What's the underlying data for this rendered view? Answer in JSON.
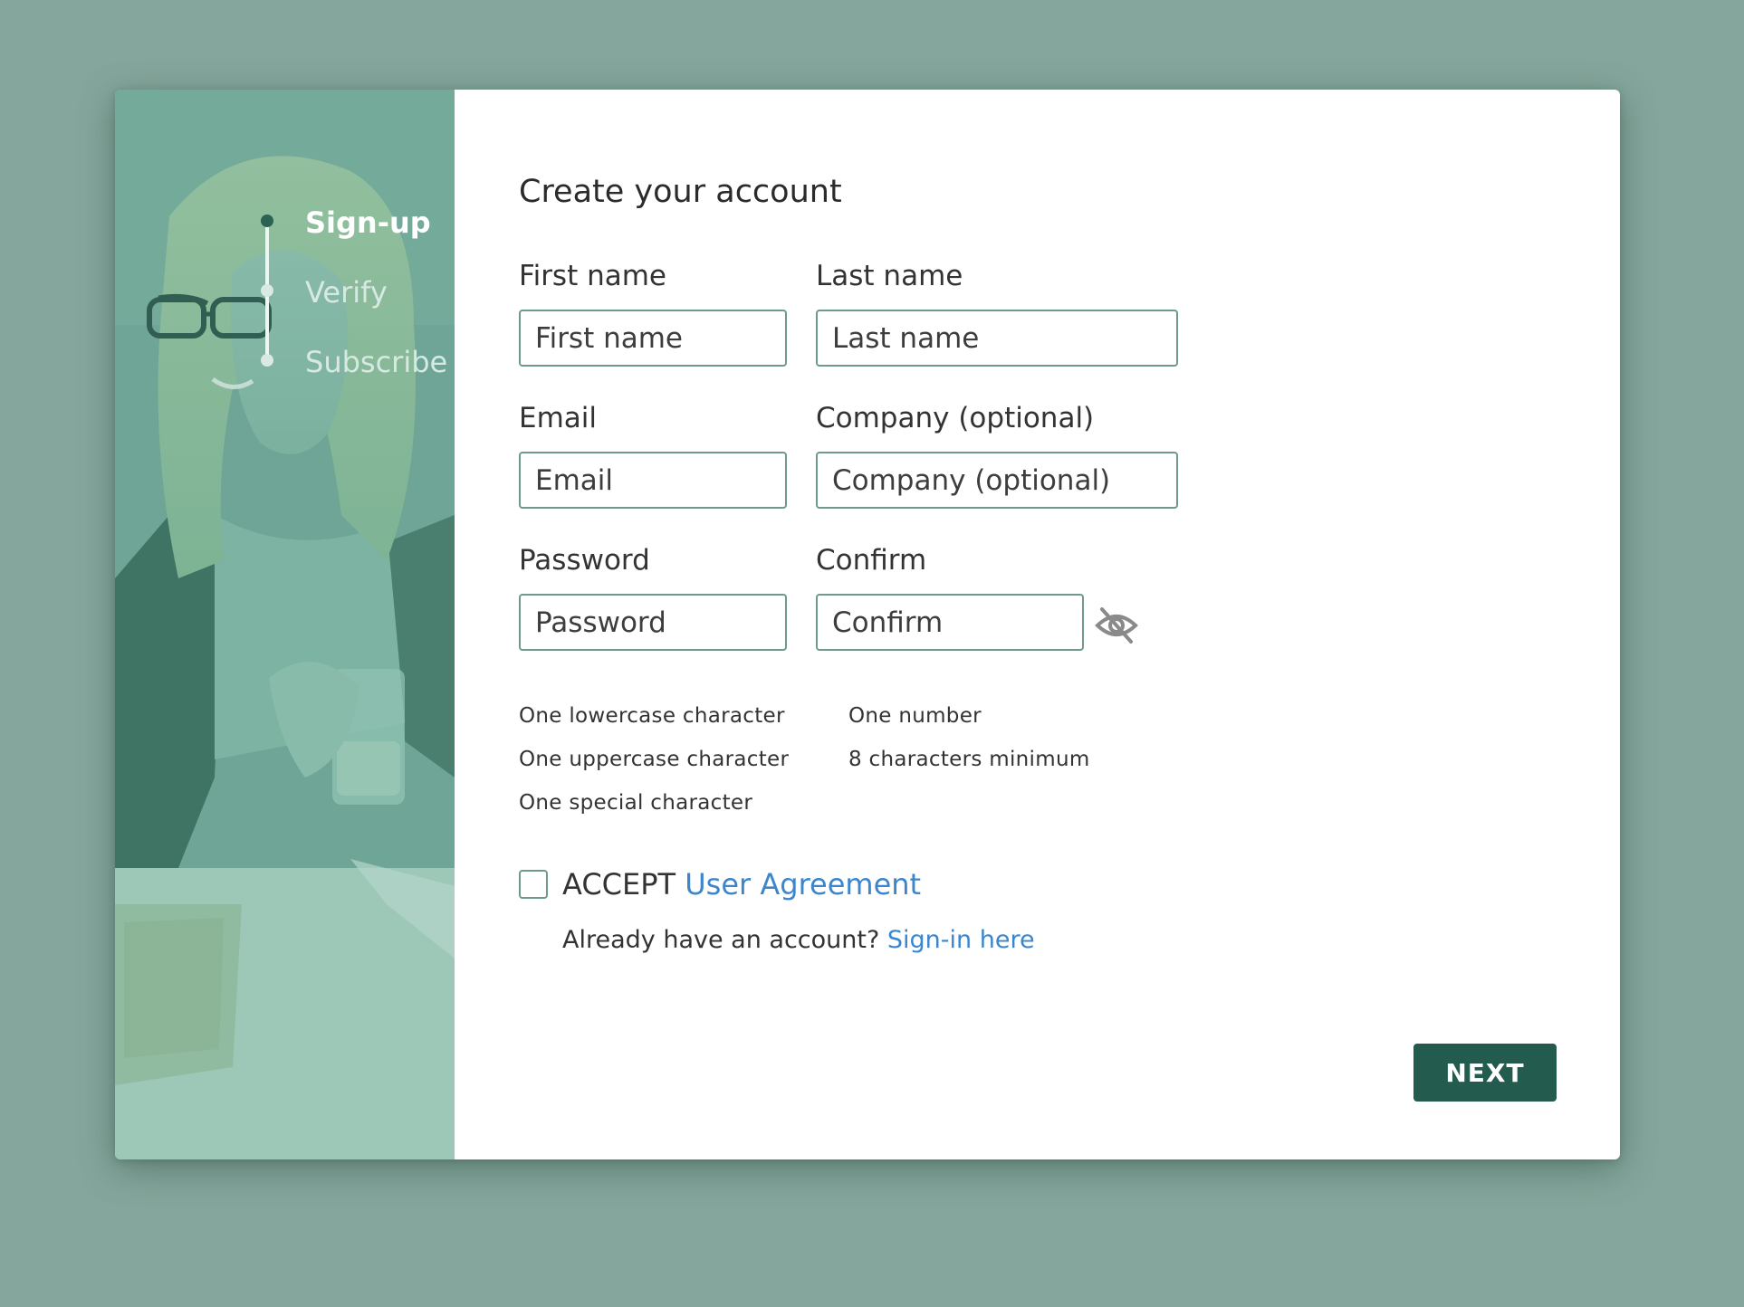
{
  "stepper": {
    "steps": [
      {
        "label": "Sign-up",
        "state": "active"
      },
      {
        "label": "Verify",
        "state": "inactive"
      },
      {
        "label": "Subscribe",
        "state": "inactive"
      }
    ]
  },
  "form": {
    "title": "Create your account",
    "first_name": {
      "label": "First name",
      "placeholder": "First name"
    },
    "last_name": {
      "label": "Last name",
      "placeholder": "Last name"
    },
    "email": {
      "label": "Email",
      "placeholder": "Email"
    },
    "company": {
      "label": "Company (optional)",
      "placeholder": "Company (optional)"
    },
    "password": {
      "label": "Password",
      "placeholder": "Password"
    },
    "confirm": {
      "label": "Confirm",
      "placeholder": "Confirm"
    },
    "visibility_toggle_icon": "eye-slash-icon"
  },
  "requirements": {
    "lowercase": "One lowercase character",
    "uppercase": "One uppercase character",
    "special": "One special character",
    "number": "One number",
    "min_length": "8 characters minimum"
  },
  "agreement": {
    "accept_label": "ACCEPT",
    "link_label": "User Agreement",
    "checked": false
  },
  "signin": {
    "prompt": "Already have an account?",
    "link_label": "Sign-in here"
  },
  "actions": {
    "next_label": "NEXT"
  },
  "colors": {
    "background": "#85a69c",
    "accent": "#235c4e",
    "link": "#3b86cc",
    "input_border": "#6e9a8c"
  }
}
